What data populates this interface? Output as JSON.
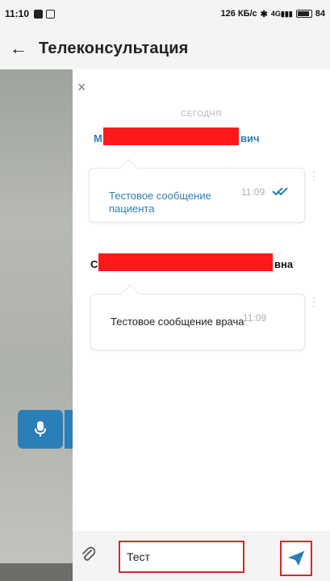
{
  "status_bar": {
    "time": "11:10",
    "network_speed": "126 КБ/с",
    "signal_label": "4G",
    "battery": "84"
  },
  "app_bar": {
    "title": "Телеконсультация",
    "back_icon": "arrow-left-icon"
  },
  "chat": {
    "date_separator": "СЕГОДНЯ",
    "messages": [
      {
        "sender_prefix": "М",
        "sender_suffix": "вич",
        "text": "Тестовое сообщение пациента",
        "time": "11:09",
        "read": true,
        "text_color": "#2b7fb8"
      },
      {
        "sender_prefix": "С",
        "sender_suffix": "вна",
        "text": "Тестовое сообщение врача",
        "time": "11:09",
        "read": false,
        "text_color": "#222222"
      }
    ]
  },
  "composer": {
    "value": "Тест",
    "attach_icon": "paperclip-icon",
    "send_icon": "send-icon"
  },
  "colors": {
    "accent": "#2b7fb8",
    "redaction": "#ff1a1a",
    "highlight_box": "#d9262c"
  }
}
